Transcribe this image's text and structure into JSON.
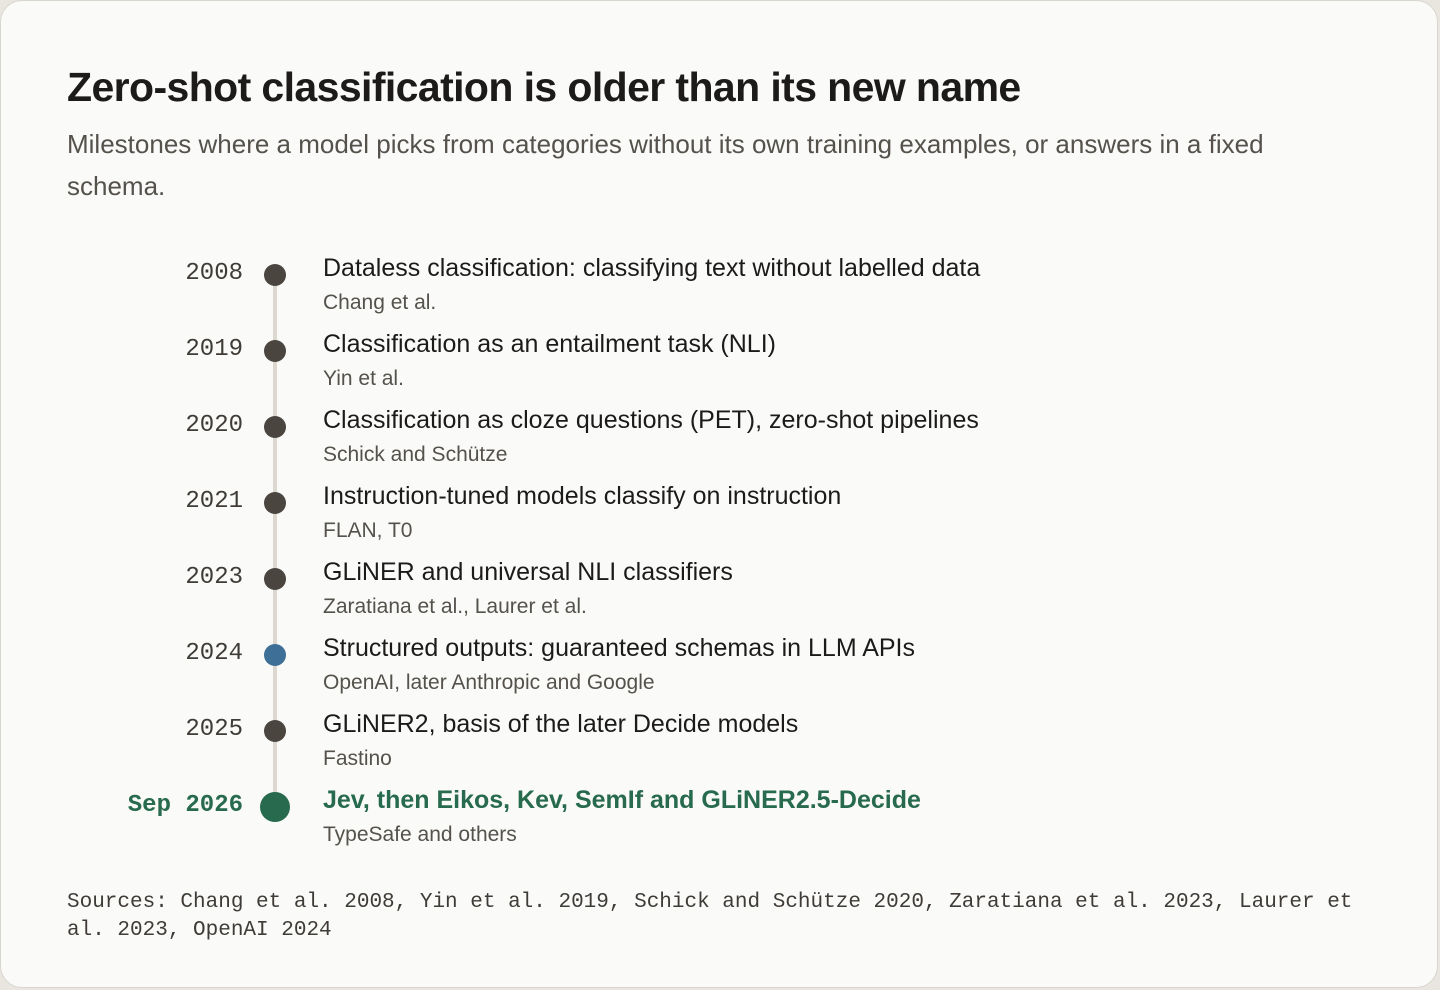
{
  "header": {
    "title": "Zero-shot classification is older than its new name",
    "subtitle": "Milestones where a model picks from categories without its own training examples, or answers in a fixed schema."
  },
  "timeline": {
    "events": [
      {
        "year": "2008",
        "title": "Dataless classification: classifying text without labelled data",
        "source": "Chang et al.",
        "style": "default"
      },
      {
        "year": "2019",
        "title": "Classification as an entailment task (NLI)",
        "source": "Yin et al.",
        "style": "default"
      },
      {
        "year": "2020",
        "title": "Classification as cloze questions (PET), zero-shot pipelines",
        "source": "Schick and Schütze",
        "style": "default"
      },
      {
        "year": "2021",
        "title": "Instruction-tuned models classify on instruction",
        "source": "FLAN, T0",
        "style": "default"
      },
      {
        "year": "2023",
        "title": "GLiNER and universal NLI classifiers",
        "source": "Zaratiana et al., Laurer et al.",
        "style": "default"
      },
      {
        "year": "2024",
        "title": "Structured outputs: guaranteed schemas in LLM APIs",
        "source": "OpenAI, later Anthropic and Google",
        "style": "blue"
      },
      {
        "year": "2025",
        "title": "GLiNER2, basis of the later Decide models",
        "source": "Fastino",
        "style": "default"
      },
      {
        "year": "Sep 2026",
        "title": "Jev, then Eikos, Kev, SemIf and GLiNER2.5-Decide",
        "source": "TypeSafe and others",
        "style": "highlight"
      }
    ]
  },
  "colors": {
    "default_dot": "#4b4540",
    "blue_dot": "#3d6f97",
    "highlight": "#276a4e",
    "axis_line": "#dcd7cf"
  },
  "footer": {
    "sources": "Sources: Chang et al. 2008, Yin et al. 2019, Schick and Schütze 2020, Zaratiana et al. 2023, Laurer et al. 2023, OpenAI 2024"
  }
}
